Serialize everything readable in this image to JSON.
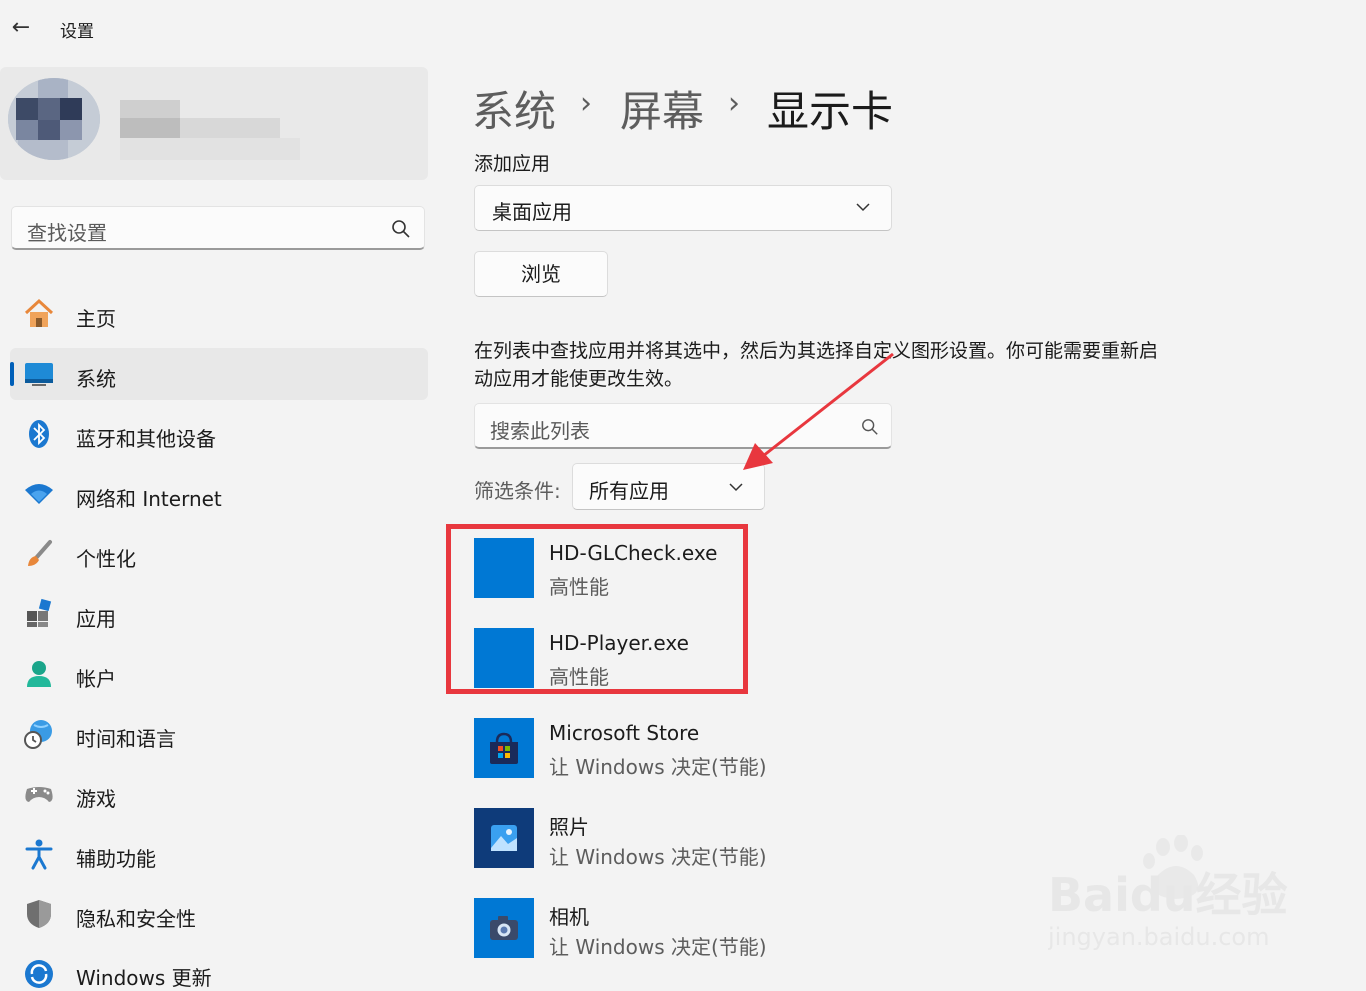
{
  "window": {
    "title": "设置"
  },
  "search": {
    "placeholder": "查找设置"
  },
  "nav": {
    "items": [
      {
        "label": "主页",
        "icon": "home-icon"
      },
      {
        "label": "系统",
        "icon": "system-display-icon",
        "active": true
      },
      {
        "label": "蓝牙和其他设备",
        "icon": "bluetooth-icon"
      },
      {
        "label": "网络和 Internet",
        "icon": "wifi-icon"
      },
      {
        "label": "个性化",
        "icon": "paintbrush-icon"
      },
      {
        "label": "应用",
        "icon": "apps-icon"
      },
      {
        "label": "帐户",
        "icon": "account-icon"
      },
      {
        "label": "时间和语言",
        "icon": "globe-clock-icon"
      },
      {
        "label": "游戏",
        "icon": "gamepad-icon"
      },
      {
        "label": "辅助功能",
        "icon": "accessibility-icon"
      },
      {
        "label": "隐私和安全性",
        "icon": "shield-icon"
      },
      {
        "label": "Windows 更新",
        "icon": "update-icon"
      }
    ]
  },
  "breadcrumb": {
    "level1": "系统",
    "level2": "屏幕",
    "current": "显示卡",
    "separator": "›"
  },
  "add_app": {
    "label": "添加应用",
    "type_selected": "桌面应用",
    "browse_label": "浏览"
  },
  "description": "在列表中查找应用并将其选中，然后为其选择自定义图形设置。你可能需要重新启动应用才能使更改生效。",
  "list_search": {
    "placeholder": "搜索此列表"
  },
  "filter": {
    "label": "筛选条件:",
    "selected": "所有应用"
  },
  "apps": [
    {
      "name": "HD-GLCheck.exe",
      "preference": "高性能",
      "icon": "blank-app-icon"
    },
    {
      "name": "HD-Player.exe",
      "preference": "高性能",
      "icon": "blank-app-icon"
    },
    {
      "name": "Microsoft Store",
      "preference": "让 Windows 决定(节能)",
      "icon": "store-icon"
    },
    {
      "name": "照片",
      "preference": "让 Windows 决定(节能)",
      "icon": "photos-icon"
    },
    {
      "name": "相机",
      "preference": "让 Windows 决定(节能)",
      "icon": "camera-icon"
    }
  ],
  "watermark": {
    "text_top": "Baidu经验",
    "text_bottom": "jingyan.baidu.com"
  },
  "colors": {
    "accent": "#005fb8",
    "app_tile": "#0078d4",
    "highlight": "#e8373e",
    "arrow": "#e8373e"
  }
}
